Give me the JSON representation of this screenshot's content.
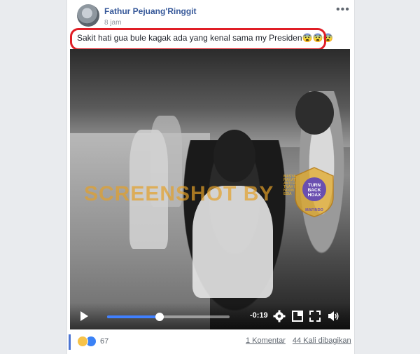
{
  "post": {
    "author": "Fathur Pejuang'Ringgit",
    "time": "8 jam",
    "caption": "Sakit hati gua bule kagak ada yang kenal sama my Presiden😨😨😨",
    "menu_icon": "more-dots-icon"
  },
  "video": {
    "watermark": "SCREENSHOT BY",
    "badge": {
      "ring_text": "MASYARAKAT ANTI FITNAH INDONESIA",
      "line1": "TURN",
      "line2": "BACK",
      "line3": "HOAX",
      "org": "MAFINDO"
    },
    "progress_fraction": 0.43,
    "remaining_time": "-0:19",
    "controls": [
      "play-icon",
      "settings-icon",
      "fullscreen-icon",
      "expand-icon",
      "volume-icon"
    ],
    "colors": {
      "progress": "#4080ff",
      "watermark": "#e2a028",
      "badge": "#6a4fb0"
    }
  },
  "footer": {
    "reaction_count": "67",
    "reaction_icons": [
      "haha-icon",
      "like-icon"
    ],
    "comments": "1 Komentar",
    "shares": "44 Kali dibagikan"
  },
  "annotation": {
    "highlight_color": "#e01e26"
  }
}
